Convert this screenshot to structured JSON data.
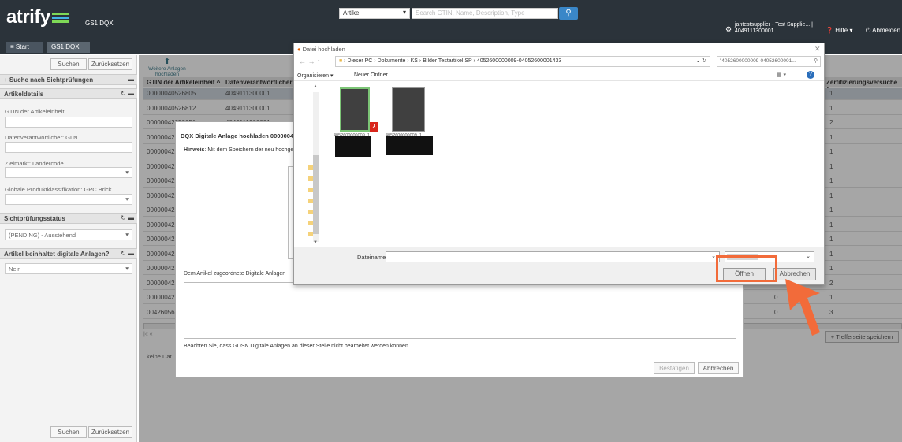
{
  "header": {
    "logo_text": "atrify",
    "app_title": "GS1 DQX",
    "search_scope": "Artikel",
    "search_placeholder": "Search GTIN, Name, Description, Type",
    "user_name": "jantestsupplier - Test Supplie... |",
    "user_gln": "4049111300001",
    "help_label": "Hilfe",
    "logout_label": "Abmelden"
  },
  "tabs": [
    {
      "label": "Start"
    },
    {
      "label": "GS1 DQX"
    }
  ],
  "sidebar": {
    "search_button": "Suchen",
    "reset_button": "Zurücksetzen",
    "section_search": "Suche nach Sichtprüfungen",
    "section_details": "Artikeldetails",
    "gtin_label": "GTIN der Artikeleinheit",
    "gln_label": "Datenverantwortlicher: GLN",
    "target_market_label": "Zielmarkt: Ländercode",
    "gpc_label": "Globale Produktklassifikation: GPC Brick",
    "status_section": "Sichtprüfungsstatus",
    "status_value": "(PENDING) - Ausstehend",
    "digital_section": "Artikel beinhaltet digitale Anlagen?",
    "digital_value": "Nein",
    "bottom_search": "Suchen",
    "bottom_reset": "Zurücksetzen"
  },
  "toolbar": {
    "upload_more": "Weitere Anlagen hochladen"
  },
  "grid": {
    "columns": [
      "GTIN der Artikeleinheit ^",
      "Datenverantwortlicher: GL",
      "Zertifizierungsversuche ^"
    ],
    "rows": [
      {
        "gtin": "00000040526805",
        "gln": "4049111300001",
        "attempts": "1"
      },
      {
        "gtin": "00000040526812",
        "gln": "4049111300001",
        "attempts": "1"
      },
      {
        "gtin": "00000042253051",
        "gln": "4049111300001",
        "attempts": "2"
      },
      {
        "gtin": "00000042",
        "gln": "",
        "attempts": "1"
      },
      {
        "gtin": "00000042",
        "gln": "",
        "attempts": "1"
      },
      {
        "gtin": "00000042",
        "gln": "",
        "attempts": "1"
      },
      {
        "gtin": "00000042",
        "gln": "",
        "attempts": "1"
      },
      {
        "gtin": "00000042",
        "gln": "",
        "attempts": "1"
      },
      {
        "gtin": "00000042",
        "gln": "",
        "attempts": "1"
      },
      {
        "gtin": "00000042",
        "gln": "",
        "attempts": "1"
      },
      {
        "gtin": "00000042",
        "gln": "",
        "attempts": "1"
      },
      {
        "gtin": "00000042",
        "gln": "",
        "attempts": "1"
      },
      {
        "gtin": "00000042",
        "gln": "",
        "attempts": "1"
      },
      {
        "gtin": "00000042",
        "gln": "",
        "attempts": "2"
      },
      {
        "gtin": "00000042",
        "gln": "",
        "attempts": "1"
      },
      {
        "gtin": "00426056",
        "gln": "",
        "attempts": "3"
      }
    ],
    "col_zero_1": "0",
    "col_zero_2": "0",
    "save_page": "Trefferseite speichern",
    "no_data": "keine Dat"
  },
  "upload_modal": {
    "title": "DQX Digitale Anlage hochladen 0000004052",
    "hint_bold": "Hinweis",
    "hint_text": ": Mit dem Speichern der neu hochge",
    "assigned_label": "Dem Artikel zugeordnete Digitale Anlagen",
    "note": "Beachten Sie, dass GDSN Digitale Anlagen an dieser Stelle nicht bearbeitet werden können.",
    "confirm_button": "Bestätigen",
    "cancel_button": "Abbrechen"
  },
  "file_dialog": {
    "title": "Datei hochladen",
    "breadcrumb": [
      "Dieser PC",
      "Dokumente",
      "KS",
      "Bilder Testartikel SP",
      "4052600000009-04052600001433"
    ],
    "search_value": "\"4052600000009-04052600001... ",
    "organize": "Organisieren",
    "new_folder": "Neuer Ordner",
    "filename_label": "Dateiname:",
    "filename_value": "",
    "open_button": "Öffnen",
    "cancel_button": "Abbrechen",
    "file1_name": "4052600000009_1",
    "file2_name": "4052600000009_1"
  },
  "colors": {
    "topbar": "#2b333a",
    "accent": "#3a87c8",
    "callout": "#f26b3a"
  }
}
